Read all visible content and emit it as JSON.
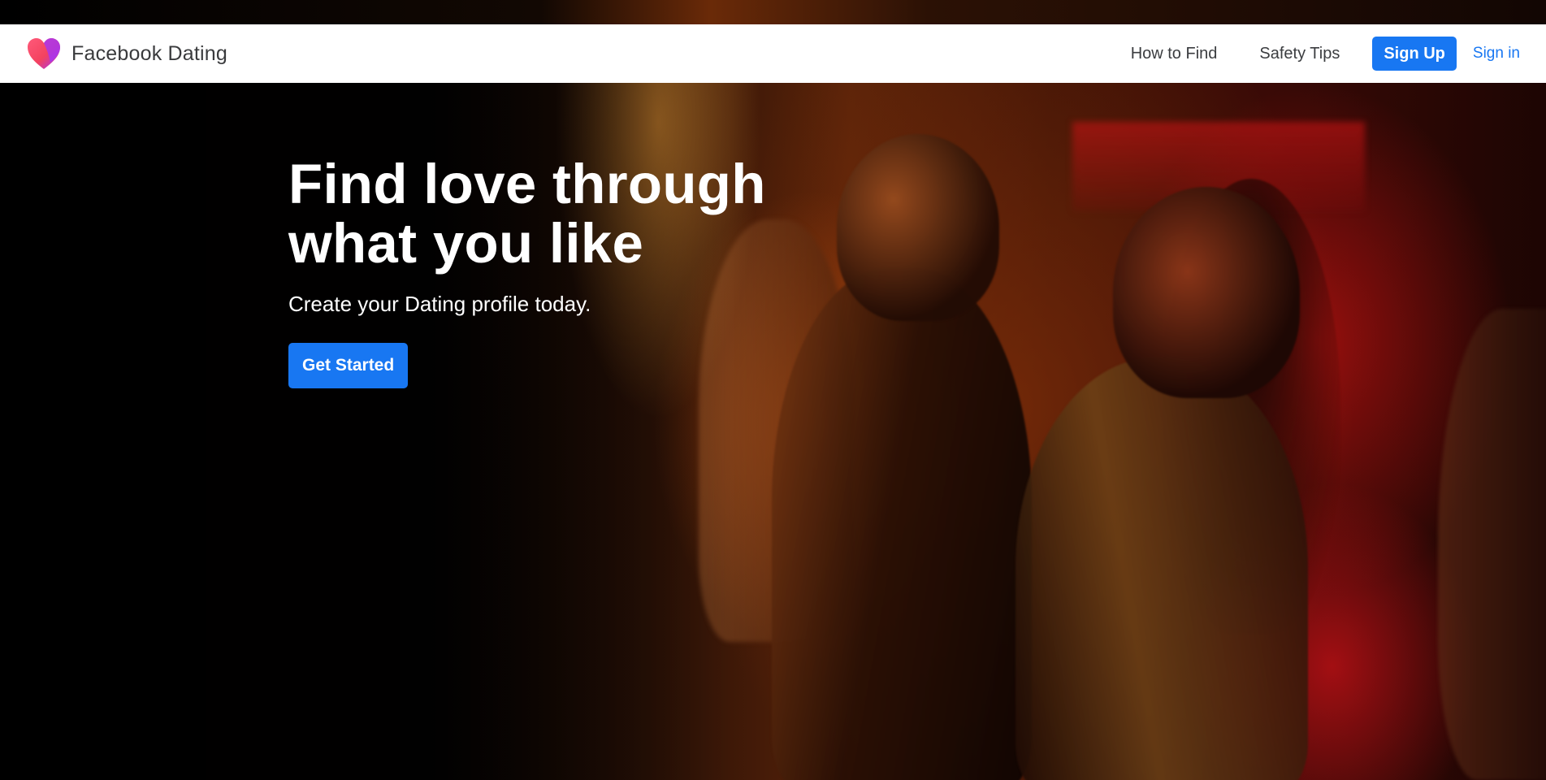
{
  "brand": {
    "name": "Facebook Dating",
    "logo_icon": "heart-icon"
  },
  "nav": {
    "links": [
      {
        "label": "How to Find"
      },
      {
        "label": "Safety Tips"
      }
    ],
    "signup_label": "Sign Up",
    "signin_label": "Sign in"
  },
  "hero": {
    "title_line1": "Find love through",
    "title_line2": "what you like",
    "subtitle": "Create your Dating profile today.",
    "cta_label": "Get Started"
  },
  "colors": {
    "accent": "#1877f2",
    "nav_background": "#ffffff",
    "hero_text": "#ffffff",
    "logo_pink": "#f3425f",
    "logo_purple": "#a033ff"
  }
}
